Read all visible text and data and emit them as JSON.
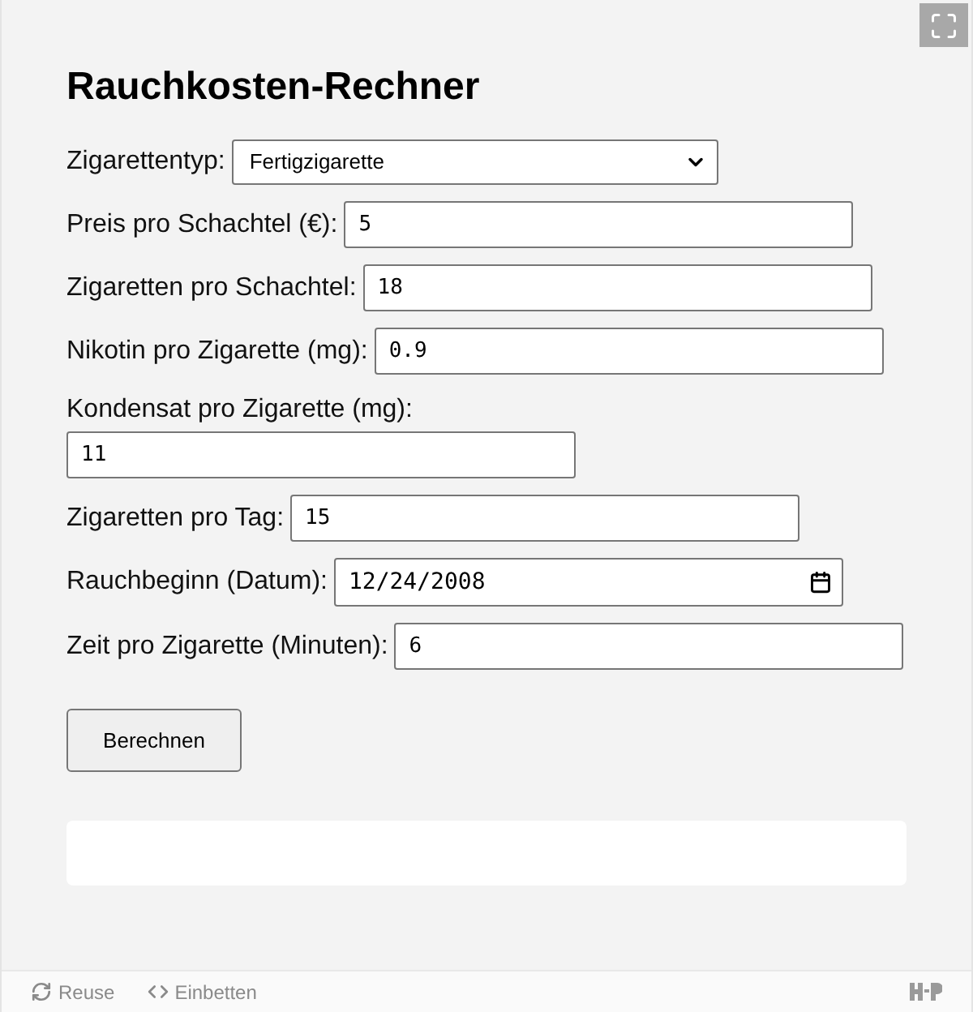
{
  "title": "Rauchkosten-Rechner",
  "fields": [
    {
      "kind": "select",
      "label": "Zigarettentyp:",
      "value": "Fertigzigarette"
    },
    {
      "kind": "text",
      "label": "Preis pro Schachtel (€):",
      "value": "5"
    },
    {
      "kind": "text",
      "label": "Zigaretten pro Schachtel:",
      "value": "18"
    },
    {
      "kind": "text",
      "label": "Nikotin pro Zigarette (mg):",
      "value": "0.9"
    },
    {
      "kind": "text",
      "label": "Kondensat pro Zigarette (mg):",
      "value": "11"
    },
    {
      "kind": "text",
      "label": "Zigaretten pro Tag:",
      "value": "15"
    },
    {
      "kind": "date",
      "label": "Rauchbeginn (Datum):",
      "value": "12/24/2008"
    },
    {
      "kind": "text",
      "label": "Zeit pro Zigarette (Minuten):",
      "value": "6"
    }
  ],
  "button": "Berechnen",
  "footer": {
    "links": [
      "Reuse",
      "Einbetten"
    ]
  }
}
